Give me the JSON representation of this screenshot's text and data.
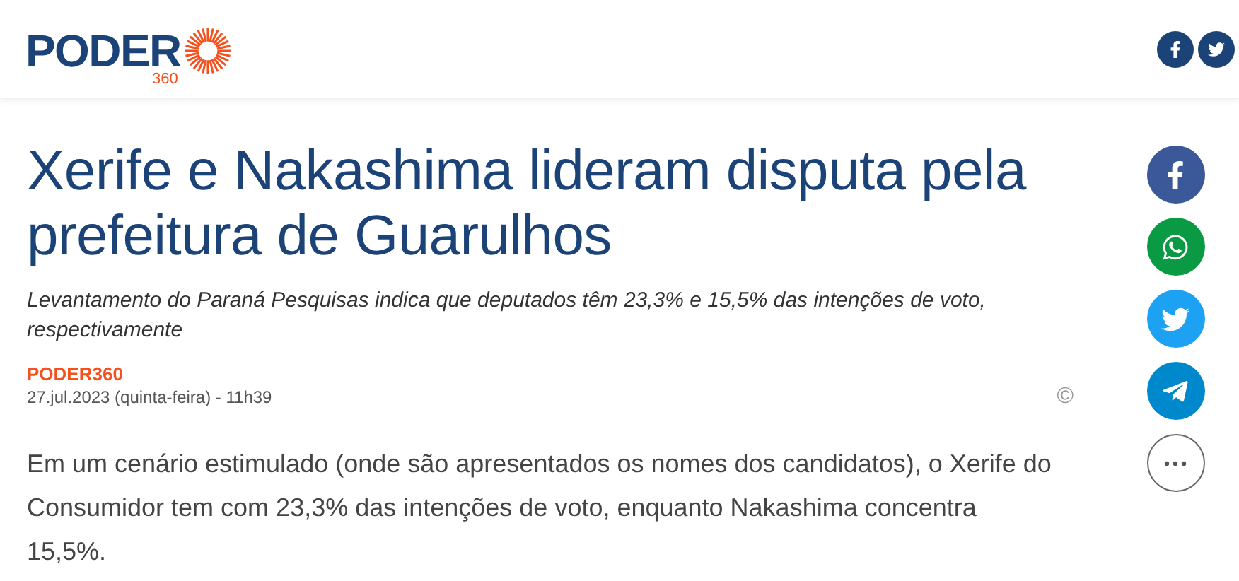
{
  "header": {
    "logo_word": "PODER",
    "logo_number": "360"
  },
  "title": "Xerife e Nakashima lideram disputa pela prefeitura de Guarulhos",
  "subtitle": "Levantamento do Paraná Pesquisas indica que deputados têm 23,3% e 15,5% das intenções de voto, respectivamente",
  "byline": {
    "author": "PODER360",
    "date": "27.jul.2023 (quinta-feira) - 11h39"
  },
  "copyright_mark": "©",
  "body": "Em um cenário estimulado (onde são apresentados os nomes dos candidatos), o Xerife do Consumidor tem com 23,3% das intenções de voto, enquanto Nakashima concentra 15,5%.",
  "header_share": [
    {
      "kind": "facebook"
    },
    {
      "kind": "twitter"
    }
  ],
  "share_buttons": [
    {
      "kind": "facebook"
    },
    {
      "kind": "whatsapp"
    },
    {
      "kind": "twitter"
    },
    {
      "kind": "telegram"
    },
    {
      "kind": "more"
    }
  ]
}
